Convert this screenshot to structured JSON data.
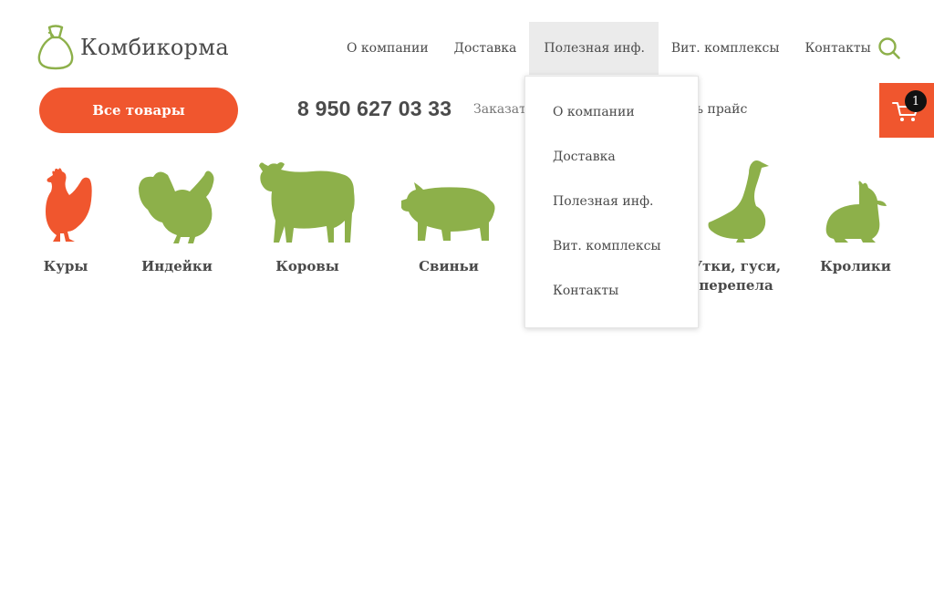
{
  "brand": {
    "name": "Комбикорма"
  },
  "nav": {
    "items": [
      {
        "label": "О компании"
      },
      {
        "label": "Доставка"
      },
      {
        "label": "Полезная инф.",
        "active": true
      },
      {
        "label": "Вит. комплексы"
      },
      {
        "label": "Контакты"
      }
    ]
  },
  "dropdown": {
    "items": [
      {
        "label": "О компании"
      },
      {
        "label": "Доставка"
      },
      {
        "label": "Полезная инф."
      },
      {
        "label": "Вит. комплексы"
      },
      {
        "label": "Контакты"
      }
    ]
  },
  "cart": {
    "count": "1",
    "icon": "cart-icon"
  },
  "search": {
    "icon": "search-icon"
  },
  "cta": {
    "all_products": "Все товары"
  },
  "contact": {
    "phone": "8 950 627 03 33",
    "order_text": "Заказать",
    "price_text": "нать прайс"
  },
  "categories": [
    {
      "label": "Куры",
      "icon": "chicken-icon"
    },
    {
      "label": "Индейки",
      "icon": "turkey-icon"
    },
    {
      "label": "Коровы",
      "icon": "cow-icon"
    },
    {
      "label": "Свиньи",
      "icon": "pig-icon"
    },
    {
      "label": "Утки, гуси,",
      "label2": "перепела",
      "icon": "goose-icon"
    },
    {
      "label": "Кролики",
      "icon": "rabbit-icon"
    }
  ],
  "colors": {
    "accent": "#f0562e",
    "green": "#8db04a",
    "text": "#4a4a4a",
    "active_nav_bg": "#ebebeb"
  }
}
